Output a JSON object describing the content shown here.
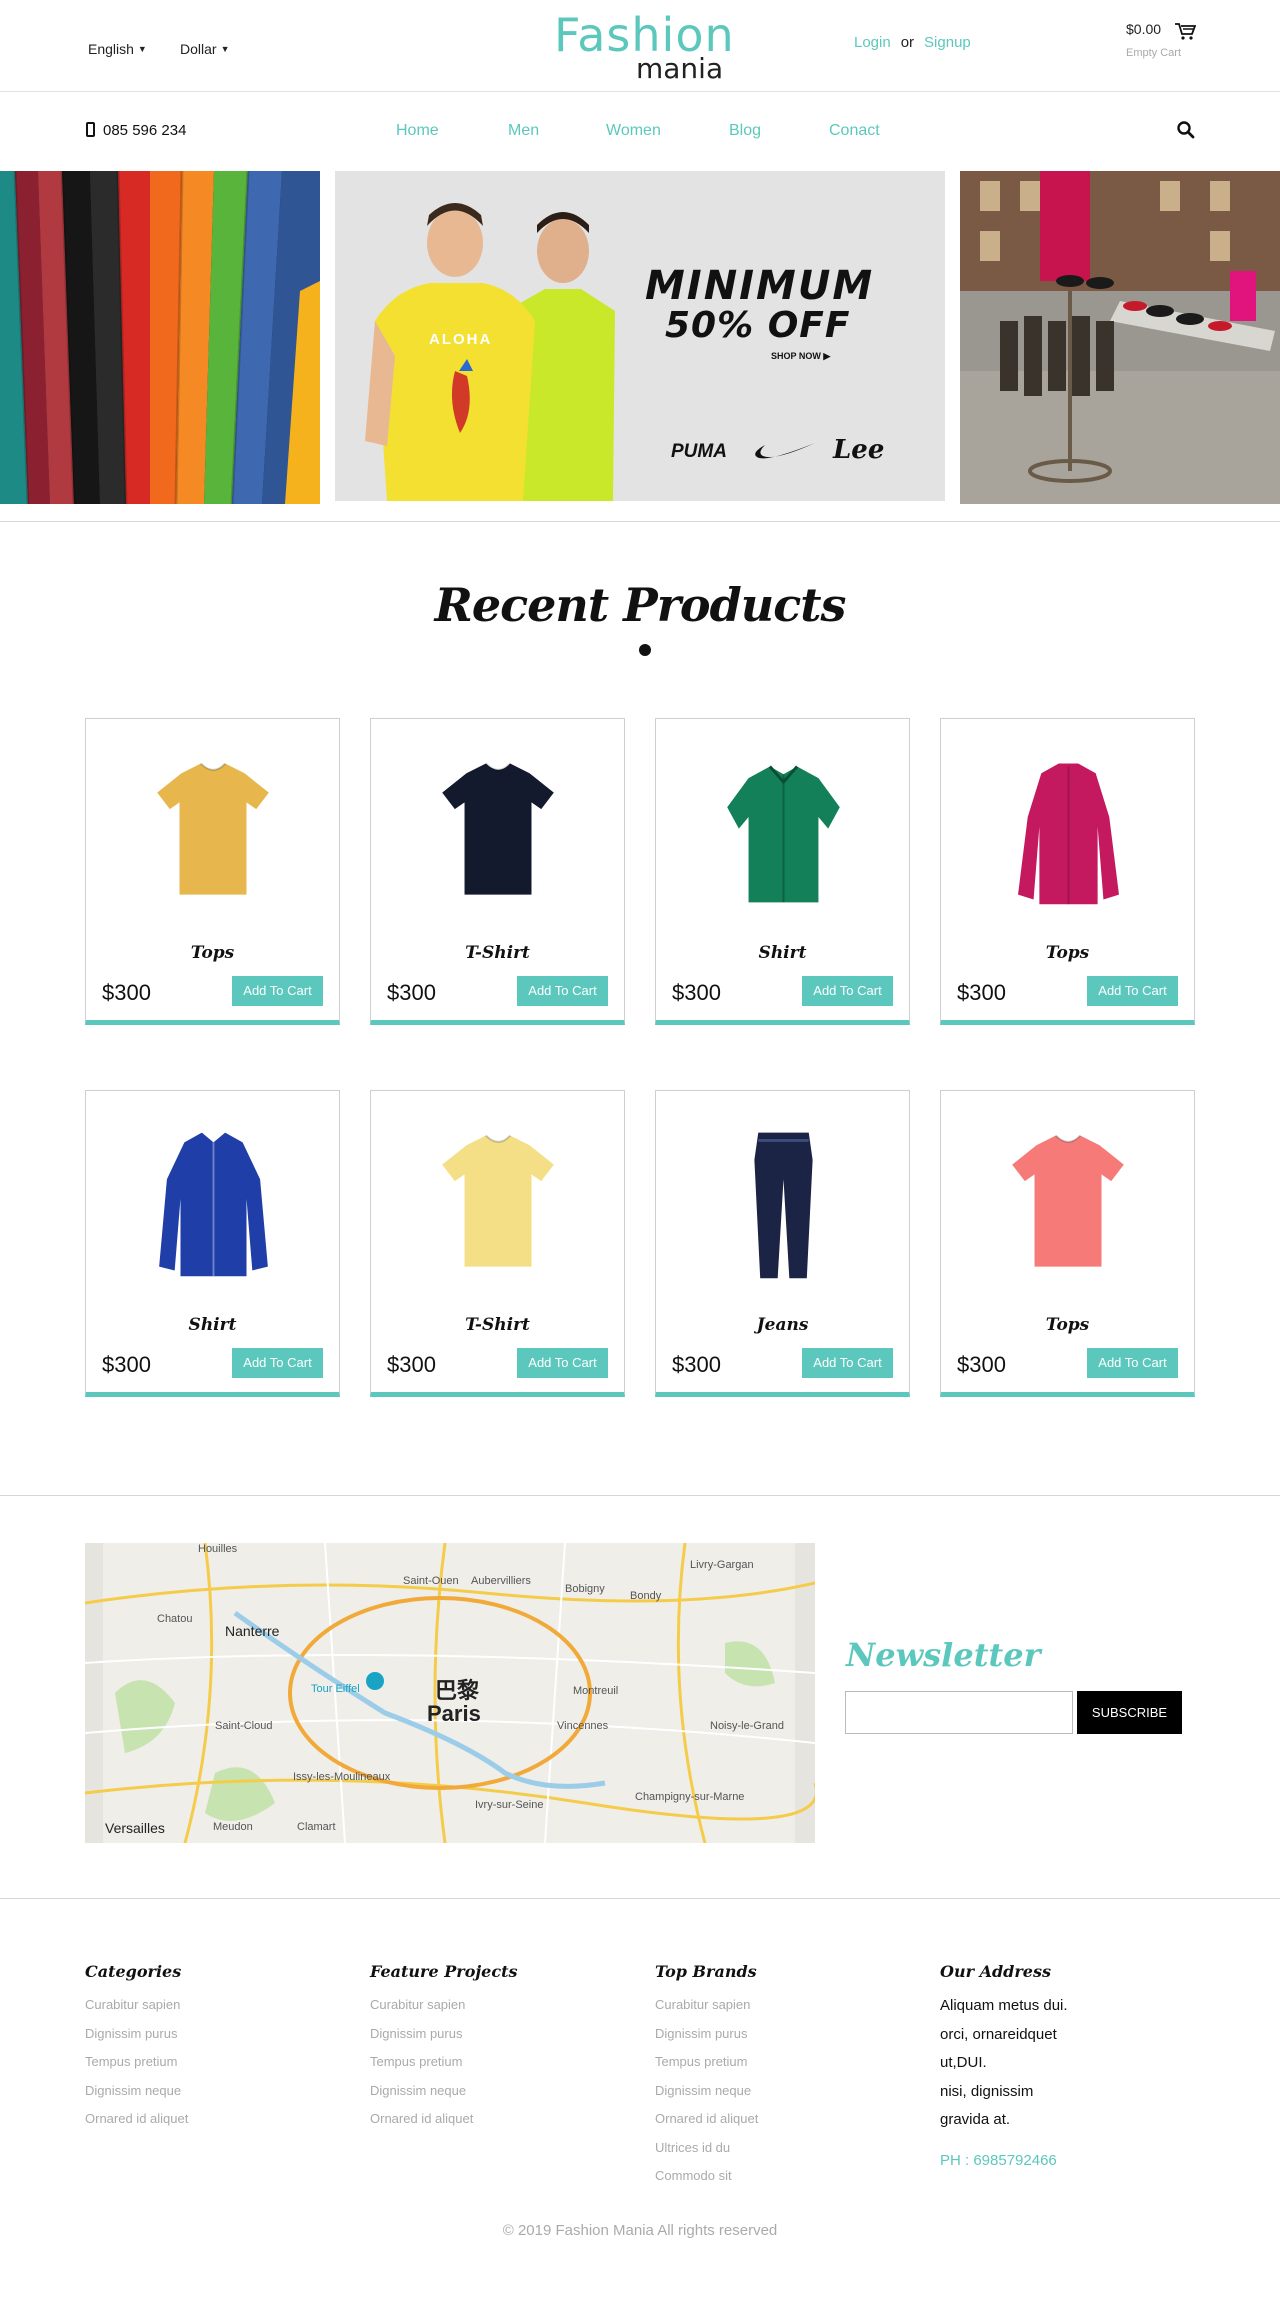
{
  "header": {
    "language": "English",
    "currency": "Dollar",
    "logo_top": "Fashion",
    "logo_bottom": "mania",
    "login": "Login",
    "or": "or",
    "signup": "Signup",
    "cart_amount": "$0.00",
    "cart_status": "Empty Cart"
  },
  "nav": {
    "phone": "085 596 234",
    "items": [
      {
        "label": "Home"
      },
      {
        "label": "Men"
      },
      {
        "label": "Women"
      },
      {
        "label": "Blog"
      },
      {
        "label": "Conact"
      }
    ]
  },
  "banner": {
    "line1": "MINIMUM",
    "line2": "50% OFF",
    "shop_now": "SHOP NOW ▶",
    "tshirt_text": "ALOHA",
    "brands": [
      "PUMA",
      "Lee"
    ]
  },
  "recent": {
    "title": "Recent Products",
    "products": [
      {
        "name": "Tops",
        "price": "$300",
        "button": "Add To Cart",
        "color": "#e7b64c",
        "kind": "tee"
      },
      {
        "name": "T-Shirt",
        "price": "$300",
        "button": "Add To Cart",
        "color": "#141a2e",
        "kind": "tee"
      },
      {
        "name": "Shirt",
        "price": "$300",
        "button": "Add To Cart",
        "color": "#13805a",
        "kind": "shirt"
      },
      {
        "name": "Tops",
        "price": "$300",
        "button": "Add To Cart",
        "color": "#c4195e",
        "kind": "cardigan"
      },
      {
        "name": "Shirt",
        "price": "$300",
        "button": "Add To Cart",
        "color": "#1f3ea8",
        "kind": "longshirt"
      },
      {
        "name": "T-Shirt",
        "price": "$300",
        "button": "Add To Cart",
        "color": "#f4de86",
        "kind": "tee"
      },
      {
        "name": "Jeans",
        "price": "$300",
        "button": "Add To Cart",
        "color": "#1b2444",
        "kind": "jeans"
      },
      {
        "name": "Tops",
        "price": "$300",
        "button": "Add To Cart",
        "color": "#f57a78",
        "kind": "tee"
      }
    ]
  },
  "map": {
    "city_cn": "巴黎",
    "city": "Paris",
    "labels": [
      "Nanterre",
      "Saint-Ouen",
      "Aubervilliers",
      "Bobigny",
      "Bondy",
      "Montreuil",
      "Vincennes",
      "Noisy-le-Grand",
      "Saint-Cloud",
      "Issy-les-Moulineaux",
      "Ivry-sur-Seine",
      "Champigny-sur-Marne",
      "Versailles",
      "Meudon",
      "Clamart",
      "Tour Eiffel",
      "Livry-Gargan",
      "Chatou",
      "Houilles"
    ]
  },
  "newsletter": {
    "title": "Newsletter",
    "input_value": "",
    "button": "SUBSCRIBE"
  },
  "footer": {
    "columns": [
      {
        "title": "Categories",
        "items": [
          "Curabitur sapien",
          "Dignissim purus",
          "Tempus pretium",
          "Dignissim neque",
          "Ornared id aliquet"
        ]
      },
      {
        "title": "Feature Projects",
        "items": [
          "Curabitur sapien",
          "Dignissim purus",
          "Tempus pretium",
          "Dignissim neque",
          "Ornared id aliquet"
        ]
      },
      {
        "title": "Top Brands",
        "items": [
          "Curabitur sapien",
          "Dignissim purus",
          "Tempus pretium",
          "Dignissim neque",
          "Ornared id aliquet",
          "Ultrices id du",
          "Commodo sit"
        ]
      }
    ],
    "address": {
      "title": "Our Address",
      "lines": [
        "Aliquam metus dui.",
        "orci, ornareidquet",
        "ut,DUI.",
        "nisi, dignissim",
        "gravida at."
      ],
      "phone": "PH : 6985792466"
    },
    "copyright": "© 2019 Fashion Mania All rights reserved"
  },
  "colors": {
    "accent": "#5cc8bd",
    "text": "#222222",
    "muted": "#aaaaaa"
  }
}
